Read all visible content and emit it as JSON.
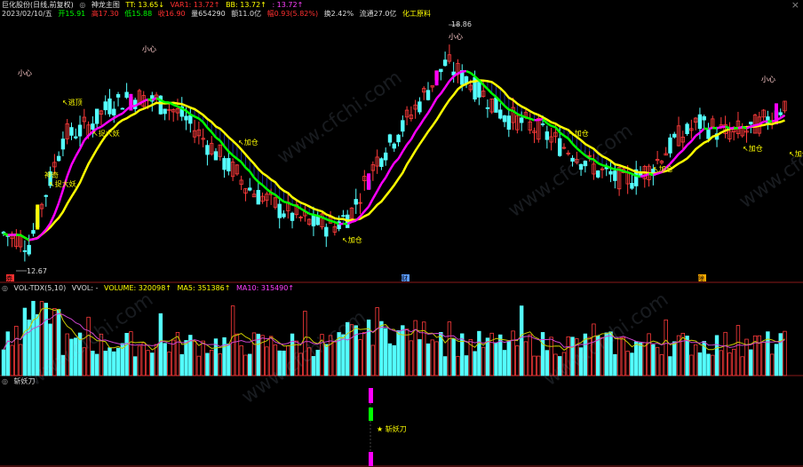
{
  "header": {
    "stock_name": "巨化股份(日线,前复权)",
    "main_indicator": "神龙主图",
    "tt": "TT: 13.65↓",
    "var1": "VAR1: 13.72↑",
    "bb": "BB: 13.72↑",
    "extra": ": 13.72↑",
    "date": "2023/02/10/五",
    "open": "开15.91",
    "high": "高17.30",
    "low": "低15.88",
    "close": "收16.90",
    "volume": "量654290",
    "amount": "额11.0亿",
    "change": "幅0.93(5.82%)",
    "turnover": "换2.42%",
    "float_cap": "流通27.0亿",
    "industry": "化工原料"
  },
  "volume_panel": {
    "title": "VOL-TDX(5,10)",
    "vvol": "VVOL: -",
    "volume": "VOLUME: 320098↑",
    "ma5": "MA5: 351386↑",
    "ma10": "MA10: 315490↑"
  },
  "signal_panel": {
    "title": "斩妖刀",
    "signal_label": "★ 斩妖刀"
  },
  "close_icon": "×",
  "watermark": "www.cfchi.com",
  "colors": {
    "up": "#ff3b3b",
    "down": "#54ffff",
    "yellow": "#ffff00",
    "green": "#00ff00",
    "magenta": "#ff00ff",
    "navy": "#1c2c9c"
  },
  "chart_data": [
    {
      "type": "candlestick",
      "price_range": [
        12.5,
        19.2
      ],
      "labels": [
        {
          "text": "18.86",
          "kind": "high-marker"
        },
        {
          "text": "12.67",
          "kind": "low-marker"
        },
        {
          "text": "小心",
          "kind": "warning"
        },
        {
          "text": "逃顶",
          "kind": "signal"
        },
        {
          "text": "捉大妖",
          "kind": "signal"
        },
        {
          "text": "神奇",
          "kind": "signal"
        },
        {
          "text": "加仓",
          "kind": "signal"
        }
      ],
      "markers": [
        "券",
        "财",
        "除"
      ]
    },
    {
      "type": "bar",
      "name": "VOLUME",
      "series": [
        "VOLUME",
        "MA5",
        "MA10"
      ]
    },
    {
      "type": "bar",
      "name": "斩妖刀",
      "series": [
        "斩妖刀"
      ]
    }
  ]
}
